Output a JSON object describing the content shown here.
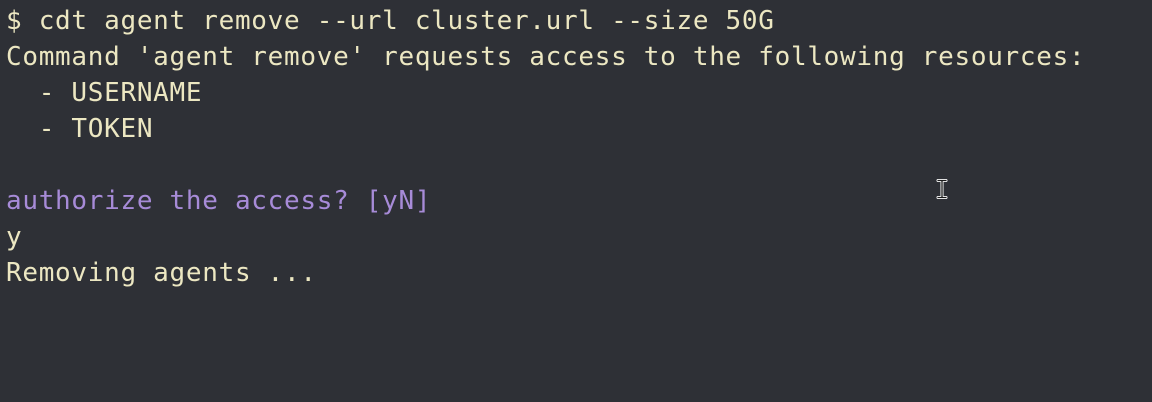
{
  "terminal": {
    "command_line": "$ cdt agent remove --url cluster.url --size 50G",
    "request_line": "Command 'agent remove' requests access to the following resources:",
    "resources": [
      "  - USERNAME",
      "  - TOKEN"
    ],
    "authorize_prompt": "authorize the access? [yN]",
    "user_input": "y",
    "status_line": "Removing agents ..."
  },
  "colors": {
    "background": "#2e3036",
    "foreground": "#ece7c2",
    "prompt": "#a78bd8"
  },
  "icons": {
    "mouse_cursor": "text-i-beam-cursor-icon"
  }
}
